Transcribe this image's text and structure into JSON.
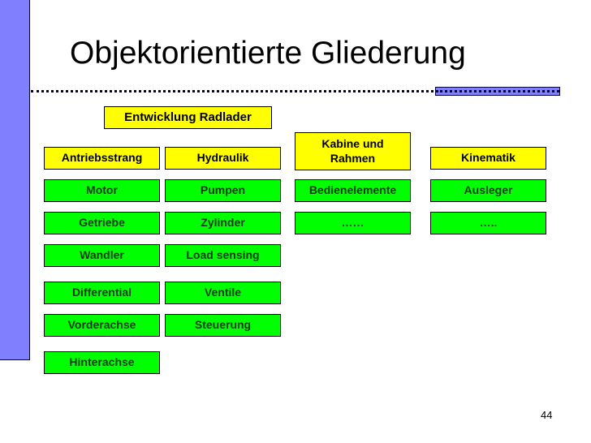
{
  "slide": {
    "title": "Objektorientierte Gliederung",
    "page_number": "44",
    "colors": {
      "accent_bar": "#8080ff",
      "category_box": "#ffff00",
      "item_box": "#00ff00",
      "line": "#000033"
    }
  },
  "hierarchy": {
    "root": "Entwicklung Radlader",
    "columns": [
      {
        "category": "Antriebsstrang",
        "items": [
          "Motor",
          "Getriebe",
          "Wandler",
          "Differential",
          "Vorderachse",
          "Hinterachse"
        ]
      },
      {
        "category": "Hydraulik",
        "items": [
          "Pumpen",
          "Zylinder",
          "Load sensing",
          "Ventile",
          "Steuerung"
        ]
      },
      {
        "category": "Kabine und Rahmen",
        "items": [
          "Bedienelemente",
          "……"
        ]
      },
      {
        "category": "Kinematik",
        "items": [
          "Ausleger",
          "….."
        ]
      }
    ]
  }
}
